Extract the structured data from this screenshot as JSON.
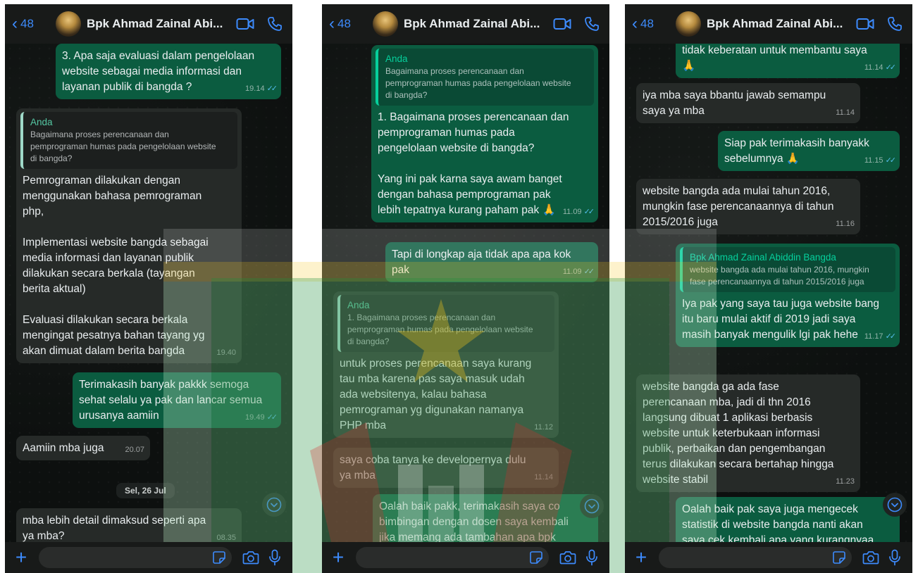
{
  "header": {
    "back_count": "48",
    "contact_name": "Bpk Ahmad Zainal Abi..."
  },
  "panel1": {
    "messages": [
      {
        "text": "3. Apa saja evaluasi dalam pengelolaan\nwebsite sebagai media informasi dan\nlayanan publik di bangda ?",
        "time": "19.14"
      },
      {
        "quote_name": "Anda",
        "quote_text": "Bagaimana proses perencanaan dan\npemprograman humas pada pengelolaan website\ndi bangda?",
        "text": "Pemrograman dilakukan dengan\nmenggunakan bahasa pemrograman\nphp,\n\nImplementasi website bangda sebagai\nmedia informasi dan layanan publik\ndilakukan secara berkala (tayangan\nberita aktual)\n\nEvaluasi dilakukan secara berkala\nmengingat pesatnya bahan tayang yg\nakan dimuat dalam berita bangda",
        "time": "19.40"
      },
      {
        "text": "Terimakasih banyak pakkk semoga\nsehat selalu ya pak dan lancar semua\nurusanya aamiin",
        "time": "19.49"
      },
      {
        "text": "Aamiin mba juga",
        "time": "20.07"
      },
      {
        "text": "mba lebih detail dimaksud seperti apa\nya mba?",
        "time": "08.35"
      }
    ],
    "date_label": "Sel, 26 Jul"
  },
  "panel2": {
    "messages": [
      {
        "quote_name": "Anda",
        "quote_text": "Bagaimana proses perencanaan dan\npemprograman humas pada pengelolaan website\ndi bangda?",
        "text": "1. Bagaimana proses perencanaan dan\npemprograman humas pada\npengelolaan website di bangda?\n\nYang ini pak karna saya awam banget\ndengan bahasa pemprograman pak\nlebih tepatnya kurang paham pak 🙏",
        "time": "11.09"
      },
      {
        "text": "Tapi di longkap aja tidak apa apa kok\npak",
        "time": "11.09"
      },
      {
        "quote_name": "Anda",
        "quote_text": "1. Bagaimana proses perencanaan dan\npemprograman humas pada pengelolaan website\ndi bangda?",
        "text": "untuk proses perencanaan saya kurang\ntau mba karena pas saya masuk udah\nada websitenya, kalau bahasa\npemrograman yg digunakan namanya\nPHP mba",
        "time": "11.12"
      },
      {
        "text": "saya coba tanya ke developernya dulu\nya mba",
        "time": "11.14"
      },
      {
        "text": "Oalah baik pakk, terimakasih saya co\nbimbingan dengan dosen saya kembali\njika memang ada tambahan apa bpk"
      }
    ]
  },
  "panel3": {
    "messages": [
      {
        "text": "tidak keberatan untuk membantu saya\n🙏",
        "time": "11.14"
      },
      {
        "text": "iya mba saya bbantu jawab semampu\nsaya ya mba",
        "time": "11.14"
      },
      {
        "text": "Siap pak terimakasih banyakk\nsebelumnya 🙏",
        "time": "11.15"
      },
      {
        "text": "website bangda ada mulai tahun 2016,\nmungkin fase perencanaannya di tahun\n2015/2016 juga",
        "time": "11.16"
      },
      {
        "quote_name": "Bpk Ahmad Zainal Abiddin Bangda",
        "quote_text": "website bangda ada mulai tahun 2016, mungkin\nfase perencanaannya di tahun 2015/2016 juga",
        "text": "Iya pak yang saya tau juga website bang\nitu baru mulai aktif di 2019 jadi saya\nmasih banyak mengulik lgi pak hehe",
        "time": "11.17"
      },
      {
        "text": "website bangda ga ada fase\nperencanaan mba, jadi di thn 2016\nlangsung dibuat 1 aplikasi berbasis\nwebsite untuk keterbukaan informasi\npublik, perbaikan dan pengembangan\nterus dilakukan secara bertahap hingga\nwebsite stabil",
        "time": "11.23"
      },
      {
        "text": "Oalah baik pak saya juga mengecek\nstatistik di website bangda nanti akan\nsaya cek kembali apa yang kurangnyaa"
      }
    ]
  },
  "colors": {
    "bubble_out": "#0b5c40",
    "bubble_in": "#262a28",
    "accent": "#3d8bfd",
    "read_ticks": "#53bdeb"
  },
  "icons": [
    "chevron-left-icon",
    "video-call-icon",
    "phone-icon",
    "plus-icon",
    "sticker-icon",
    "camera-icon",
    "microphone-icon",
    "chevron-down-icon"
  ]
}
